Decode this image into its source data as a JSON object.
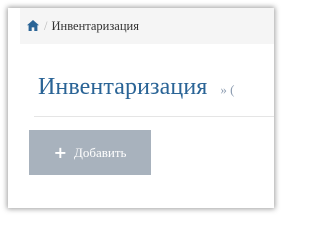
{
  "breadcrumb": {
    "home_icon": "home-icon",
    "separator": "/",
    "current": "Инвентаризация"
  },
  "page": {
    "title": "Инвентаризация",
    "subtitle": "» ("
  },
  "actions": {
    "add_label": "Добавить",
    "add_icon": "+"
  },
  "colors": {
    "title": "#2a6496",
    "button_bg": "#a8b2bd",
    "breadcrumb_bg": "#f5f5f5"
  }
}
